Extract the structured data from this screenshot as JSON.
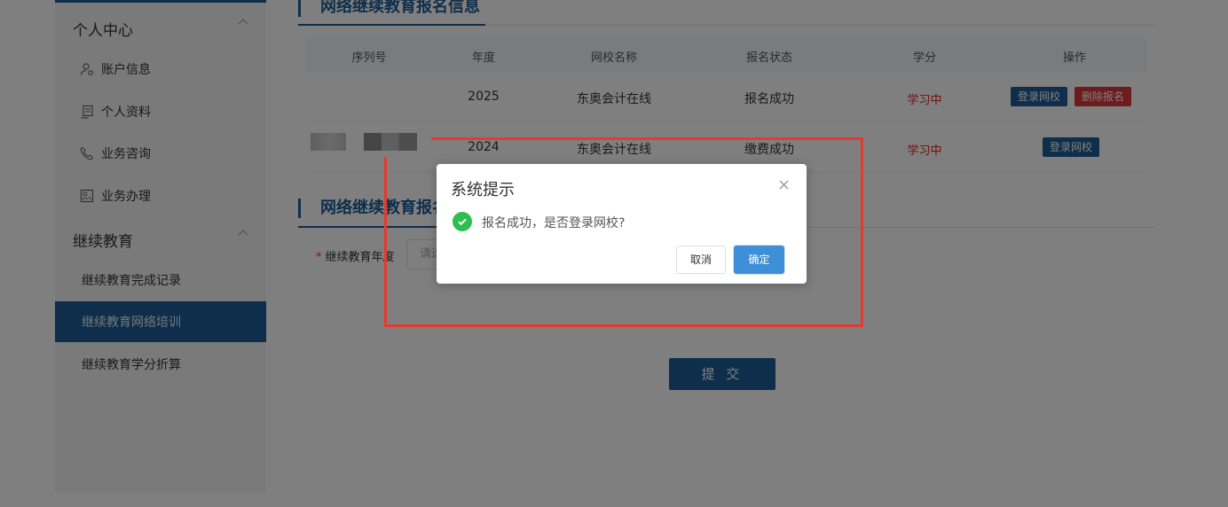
{
  "sidebar": {
    "groups": [
      {
        "label": "个人中心"
      },
      {
        "label": "继续教育"
      }
    ],
    "personal_items": [
      {
        "label": "账户信息",
        "icon": "user-gear-icon"
      },
      {
        "label": "个人资料",
        "icon": "profile-card-icon"
      },
      {
        "label": "业务咨询",
        "icon": "phone-icon"
      },
      {
        "label": "业务办理",
        "icon": "id-badge-icon"
      }
    ],
    "edu_items": [
      {
        "label": "继续教育完成记录"
      },
      {
        "label": "继续教育网络培训"
      },
      {
        "label": "继续教育学分折算"
      }
    ]
  },
  "main": {
    "section1_title": "网络继续教育报名信息",
    "table": {
      "headers": [
        "序列号",
        "年度",
        "网校名称",
        "报名状态",
        "学分",
        "操作"
      ],
      "rows": [
        {
          "serial": "",
          "year": "2025",
          "school": "东奥会计在线",
          "status": "报名成功",
          "credit": "学习中",
          "actions": [
            "登录网校",
            "删除报名"
          ]
        },
        {
          "serial": "",
          "year": "2024",
          "school": "东奥会计在线",
          "status": "缴费成功",
          "credit": "学习中",
          "actions": [
            "登录网校"
          ]
        }
      ]
    },
    "section2_title": "网络继续教育报名",
    "form": {
      "year_label": "继续教育年度",
      "year_placeholder": "请选"
    },
    "submit_label": "提 交"
  },
  "dialog": {
    "title": "系统提示",
    "message": "报名成功，是否登录网校?",
    "cancel_label": "取消",
    "ok_label": "确定"
  },
  "colors": {
    "brand": "#1d5c96",
    "danger": "#d8383a",
    "success": "#2cbe4e",
    "annotation": "#e8392d"
  }
}
